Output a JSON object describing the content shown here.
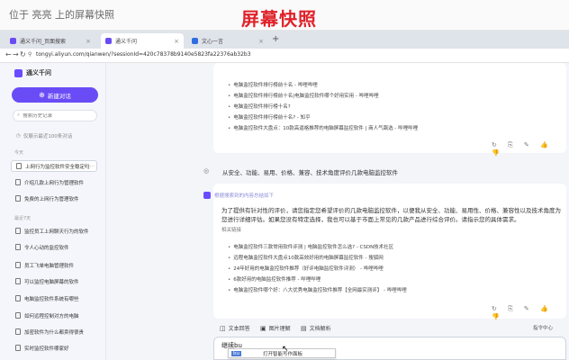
{
  "overlay": {
    "window_title": "位于 亮亮 上的屏幕快照",
    "big_title": "屏幕快照"
  },
  "browser": {
    "tabs": [
      {
        "label": "通义千问_页面搜索",
        "active": false
      },
      {
        "label": "通义千问",
        "active": true
      },
      {
        "label": "文心一言",
        "active": false
      }
    ],
    "new_tab": "+",
    "url": "tongyi.aliyun.com/qianwen/?sessionId=420c78378b9140e5823fa22376ab32b3"
  },
  "sidebar": {
    "logo": "通义千问",
    "new_chat": "新建对话",
    "search_placeholder": "搜索历史记录",
    "history_note": "仅展示最近100条对话",
    "sections": [
      {
        "label": "今天",
        "items": [
          {
            "label": "上网行为监控软件安全稳定吗",
            "active": true
          },
          {
            "label": "介绍几款上网行为管理软件",
            "active": false
          },
          {
            "label": "免费的上网行为管理软件",
            "active": false
          }
        ]
      },
      {
        "label": "最近7天",
        "items": [
          {
            "label": "监控员工上网聊天行为的软件",
            "active": false
          },
          {
            "label": "令人心动的监控软件",
            "active": false
          },
          {
            "label": "员工飞单电脑管理软件",
            "active": false
          },
          {
            "label": "可以监控电脑屏幕的软件",
            "active": false
          },
          {
            "label": "电脑监控软件系统有哪些",
            "active": false
          },
          {
            "label": "如何远程控制对方的电脑",
            "active": false
          },
          {
            "label": "加密软件为什么都卖得很贵",
            "active": false
          },
          {
            "label": "实时监控软件哪家好",
            "active": false
          }
        ]
      }
    ]
  },
  "chat": {
    "top_bullets": [
      "电脑监控软件排行榜前十名 - 哔哩哔哩",
      "电脑监控软件排行榜前十名|电脑监控软件哪个好用实用 - 哔哩哔哩",
      "电脑监控软件排行榜十名?",
      "电脑监控软件排行榜前十名? - 知乎",
      "电脑监控软件大盘点：10款高逼格推荐的电脑屏幕监控软件 | 商人气飙选 - 哔哩哔哩"
    ],
    "user_message": "从安全、功能、易用、价格、兼容、技术角度评价几款电脑监控软件",
    "ai_sub": "根据搜索到的内容总结如下",
    "ai_paragraph": "为了提供有针对性的评价，请您指定您希望评价的几款电脑监控软件，以便我从安全、功能、易用性、价格、兼容性以及技术角度为您进行详细评估。如果您没有特定选择，我也可以基于市面上常见的几款产品进行综合评价。请指示您的具体需求。",
    "sources_label": "相关链接",
    "sources": [
      "电脑监控软件三款常用软件评测 | 电脑监控软件怎么选? - CSDN技术社区",
      "远程电脑监控软件大盘点10款高效好用的电脑屏幕监控软件 - 搜狐网",
      "24年好用的电脑监控软件推荐（好评电脑监控软件评测） - 哔哩哔哩",
      "6款好用的电脑监控软件推荐 - 哔哩哔哩",
      "电脑监控软件哪个好：八大优秀电脑监控软件推荐【全网最实测评】 - 哔哩哔哩"
    ],
    "action_icons": "↻ ⎘ ✎ 👍 👎"
  },
  "composer": {
    "tabs": [
      "文本回答",
      "图片理解",
      "文档解析"
    ],
    "command_center": "指令中心",
    "input_text": "继续bu",
    "ime_selected": "bu",
    "ime_candidate": "打开智能写作面板"
  },
  "colors": {
    "accent": "#6a4cf6",
    "title_red": "#e0212a"
  }
}
